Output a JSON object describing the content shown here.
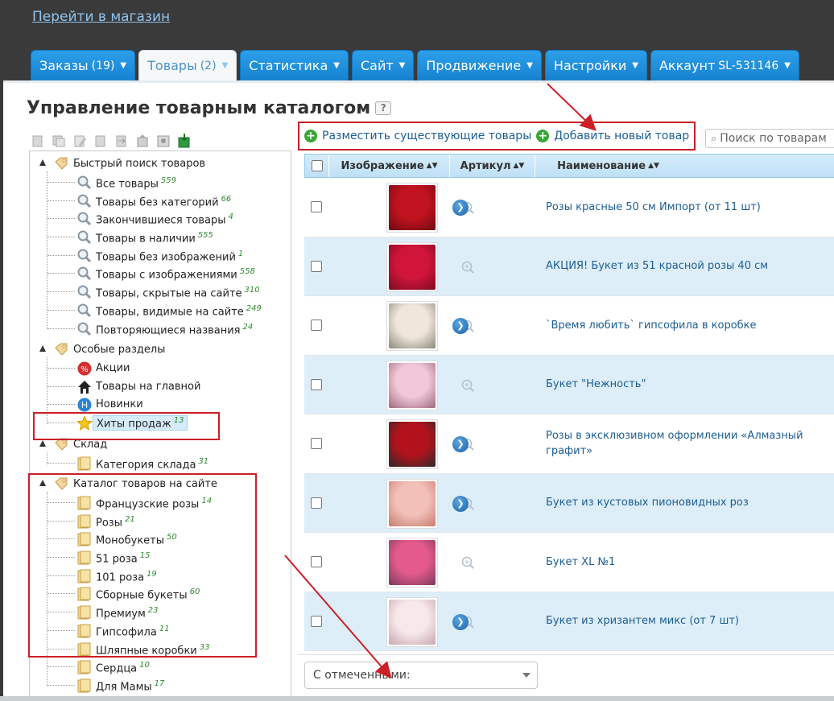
{
  "header": {
    "store_link": "Перейти в магазин"
  },
  "tabs": [
    {
      "label": "Заказы",
      "count": "(19)",
      "active": false
    },
    {
      "label": "Товары",
      "count": "(2)",
      "active": true
    },
    {
      "label": "Статистика",
      "count": "",
      "active": false
    },
    {
      "label": "Сайт",
      "count": "",
      "active": false
    },
    {
      "label": "Продвижение",
      "count": "",
      "active": false
    },
    {
      "label": "Настройки",
      "count": "",
      "active": false
    },
    {
      "label": "Аккаунт",
      "count": "SL-531146",
      "active": false
    }
  ],
  "page": {
    "title": "Управление товарным каталогом",
    "help": "?"
  },
  "actions": {
    "place_existing": "Разместить существующие товары",
    "add_new": "Добавить новый товар"
  },
  "search": {
    "placeholder": "Поиск по товарам"
  },
  "tree": {
    "quick": {
      "label": "Быстрый поиск товаров",
      "items": [
        {
          "label": "Все товары",
          "count": "559"
        },
        {
          "label": "Товары без категорий",
          "count": "66"
        },
        {
          "label": "Закончившиеся товары",
          "count": "4"
        },
        {
          "label": "Товары в наличии",
          "count": "555"
        },
        {
          "label": "Товары без изображений",
          "count": "1"
        },
        {
          "label": "Товары с изображениями",
          "count": "558"
        },
        {
          "label": "Товары, скрытые на сайте",
          "count": "310"
        },
        {
          "label": "Товары, видимые на сайте",
          "count": "249"
        },
        {
          "label": "Повторяющиеся названия",
          "count": "24"
        }
      ]
    },
    "special": {
      "label": "Особые разделы",
      "items": [
        {
          "label": "Акции",
          "count": "",
          "icon": "percent-icon"
        },
        {
          "label": "Товары на главной",
          "count": "",
          "icon": "home-icon"
        },
        {
          "label": "Новинки",
          "count": "",
          "icon": "new-icon"
        },
        {
          "label": "Хиты продаж",
          "count": "13",
          "icon": "star-icon"
        }
      ]
    },
    "stock": {
      "label": "Склад",
      "items": [
        {
          "label": "Категория склада",
          "count": "31"
        }
      ]
    },
    "catalog": {
      "label": "Каталог товаров на сайте",
      "items": [
        {
          "label": "Французские розы",
          "count": "14"
        },
        {
          "label": "Розы",
          "count": "21"
        },
        {
          "label": "Монобукеты",
          "count": "50"
        },
        {
          "label": "51 роза",
          "count": "15"
        },
        {
          "label": "101 роза",
          "count": "19"
        },
        {
          "label": "Сборные букеты",
          "count": "60"
        },
        {
          "label": "Премиум",
          "count": "23"
        },
        {
          "label": "Гипсофила",
          "count": "11"
        },
        {
          "label": "Шляпные коробки",
          "count": "33"
        },
        {
          "label": "Сердца",
          "count": "10"
        },
        {
          "label": "Для Мамы",
          "count": "17"
        }
      ]
    }
  },
  "grid": {
    "columns": {
      "image": "Изображение",
      "sku": "Артикул",
      "name": "Наименование"
    },
    "rows": [
      {
        "name": "Розы красные 50 см Импорт (от 11 шт)",
        "has_arrow": true,
        "c1": "#c0121f",
        "c2": "#6e0a10"
      },
      {
        "name": "АКЦИЯ! Букет из 51 красной розы 40 см",
        "has_arrow": false,
        "c1": "#d0143a",
        "c2": "#7d0a22"
      },
      {
        "name": "`Время любить` гипсофила в коробке",
        "has_arrow": true,
        "c1": "#f1e6dc",
        "c2": "#8a8a7c"
      },
      {
        "name": "Букет \"Нежность\"",
        "has_arrow": false,
        "c1": "#f0c8d8",
        "c2": "#a06a80"
      },
      {
        "name": "Розы в эксклюзивном оформлении «Алмазный графит»",
        "has_arrow": true,
        "c1": "#b1121c",
        "c2": "#2b2b2b"
      },
      {
        "name": "Букет из кустовых пионовидных роз",
        "has_arrow": true,
        "c1": "#f2c0b8",
        "c2": "#c77d70"
      },
      {
        "name": "Букет XL №1",
        "has_arrow": false,
        "c1": "#e45a8a",
        "c2": "#7a3a5c"
      },
      {
        "name": "Букет из хризантем микс (от 7 шт)",
        "has_arrow": true,
        "c1": "#f7e8ea",
        "c2": "#c6a7b2"
      }
    ]
  },
  "bulk": {
    "label": "С отмеченными:"
  },
  "colors": {
    "tab_blue": "#1f8fe0",
    "annotation_red": "#cc1f27",
    "link": "#1c5d94",
    "count_green": "#2f8a2f"
  }
}
